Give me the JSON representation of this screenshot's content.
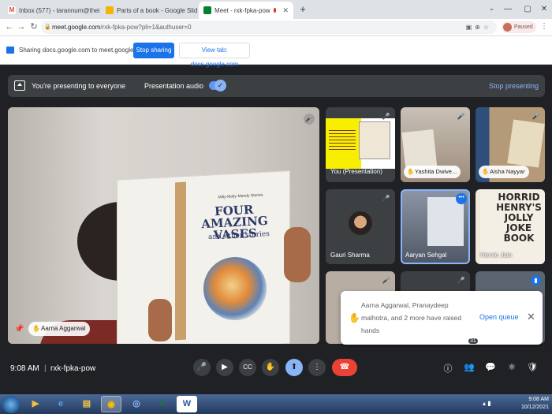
{
  "browser": {
    "tabs": [
      {
        "label": "Inbox (577) - tarannum@theindi",
        "fav": "M",
        "favcolor": "#ea4335"
      },
      {
        "label": "Parts of a book - Google Slid",
        "fav": "",
        "favcolor": "#f4b400"
      },
      {
        "label": "Meet - rxk-fpka-pow",
        "fav": "",
        "favcolor": "#00832d"
      }
    ],
    "url_host": "meet.google.com",
    "url_rest": "/rxk-fpka-pow?pli=1&authuser=0",
    "profile_label": "Paused"
  },
  "sharebar": {
    "text": "Sharing docs.google.com to meet.google.com",
    "stop_sharing": "Stop sharing",
    "view_tab": "View tab: docs.google.com"
  },
  "presenting": {
    "message": "You're presenting to everyone",
    "audio_label": "Presentation audio",
    "stop_label": "Stop presenting"
  },
  "main_video": {
    "name": "Aarna Aggarwal",
    "book_top": "Milly-Molly-Mandy Stories",
    "book_title": "FOUR AMAZING VASES",
    "book_subtitle": "and other stories"
  },
  "tiles": {
    "presentation": {
      "label": "You (Presentation)"
    },
    "yashita": {
      "label": "Yashita Dwive..."
    },
    "aisha": {
      "label": "Aisha Nayyar"
    },
    "gauri": {
      "label": "Gauri Sharma"
    },
    "aaryan": {
      "label": "Aaryan Sehgal"
    },
    "hervie": {
      "label": "Hervie Jain",
      "book": "HORRID HENRY'S JOLLY JOKE BOOK"
    }
  },
  "toast": {
    "message": "Aarna Aggarwal, Pranaydeep malhotra, and 2 more have raised hands",
    "action": "Open queue"
  },
  "bottom": {
    "time": "9:08 AM",
    "separator": "|",
    "meeting_code": "rxk-fpka-pow",
    "participant_count": "31"
  },
  "taskbar": {
    "time": "9:08 AM",
    "date": "10/12/2021"
  }
}
